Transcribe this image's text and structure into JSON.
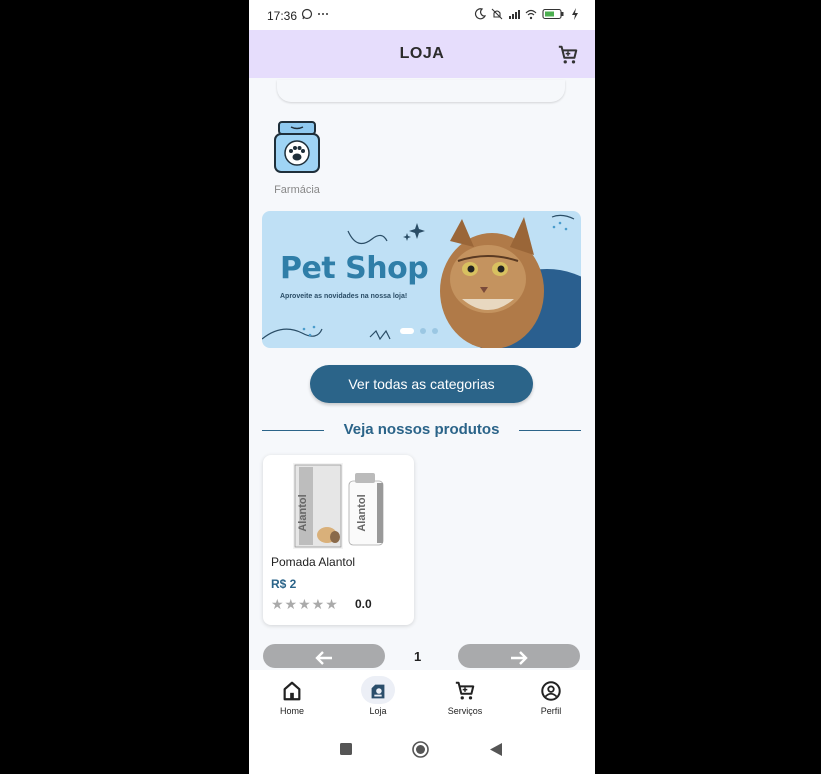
{
  "status_bar": {
    "time": "17:36",
    "left_icons": [
      "whatsapp-icon",
      "more-dots-icon"
    ],
    "right_icons": [
      "moon-icon",
      "mute-icon",
      "signal-icon",
      "wifi-icon",
      "battery-icon",
      "charging-icon"
    ]
  },
  "app_bar": {
    "title": "LOJA",
    "cart_icon": "cart-icon"
  },
  "categories": [
    {
      "label": "Farmácia",
      "icon": "pharmacy-jar-icon"
    }
  ],
  "banner": {
    "title": "Pet Shop",
    "subtitle": "Aproveite as novidades na nossa loja!",
    "slide_count": 3,
    "active_slide": 1
  },
  "all_categories_button": "Ver todas as categorias",
  "products_section_title": "Veja nossos produtos",
  "products": [
    {
      "name": "Pomada Alantol",
      "price": "R$ 2",
      "rating": "0.0",
      "stars_filled": 0,
      "stars_total": 5
    }
  ],
  "pager": {
    "prev_icon": "arrow-left-icon",
    "next_icon": "arrow-right-icon",
    "page": "1"
  },
  "bottom_nav": [
    {
      "label": "Home",
      "icon": "home-icon",
      "active": false
    },
    {
      "label": "Loja",
      "icon": "store-icon",
      "active": true
    },
    {
      "label": "Serviços",
      "icon": "cart-icon",
      "active": false
    },
    {
      "label": "Perfil",
      "icon": "profile-icon",
      "active": false
    }
  ],
  "colors": {
    "app_bar": "#e6ddfc",
    "primary": "#2b6489",
    "banner_bg": "#bfe0f5",
    "pager_button": "#a9aaac"
  }
}
